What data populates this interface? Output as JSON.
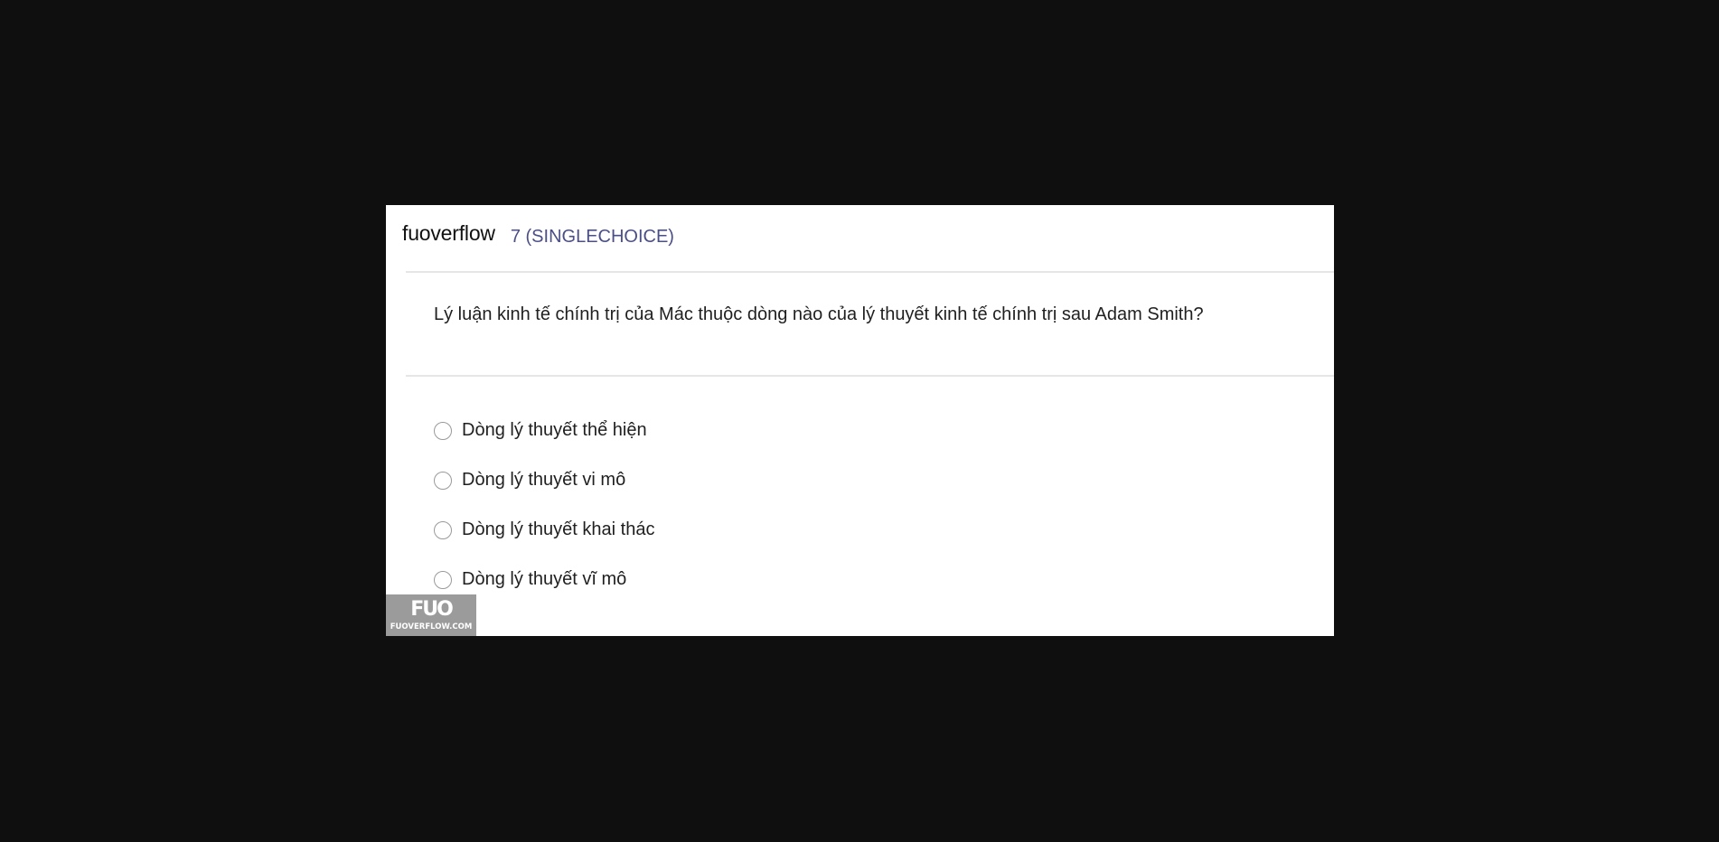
{
  "header": {
    "brand": "fuoverflow",
    "question_number": "7 (SINGLECHOICE)"
  },
  "question": {
    "text": "Lý luận kinh tế chính trị của Mác thuộc dòng nào của lý thuyết kinh tế chính trị sau Adam Smith?"
  },
  "options": [
    {
      "label": "Dòng lý thuyết thể hiện",
      "selected": false
    },
    {
      "label": "Dòng lý thuyết vi mô",
      "selected": false
    },
    {
      "label": "Dòng lý thuyết khai thác",
      "selected": false
    },
    {
      "label": "Dòng lý thuyết vĩ mô",
      "selected": false
    }
  ],
  "watermark": {
    "logo": "FUO",
    "url": "FUOVERFLOW.COM"
  },
  "colors": {
    "backdrop": "#0f0f0f",
    "card": "#ffffff",
    "question_number": "#4b4f86",
    "watermark_bg": "#9b9b9b"
  }
}
